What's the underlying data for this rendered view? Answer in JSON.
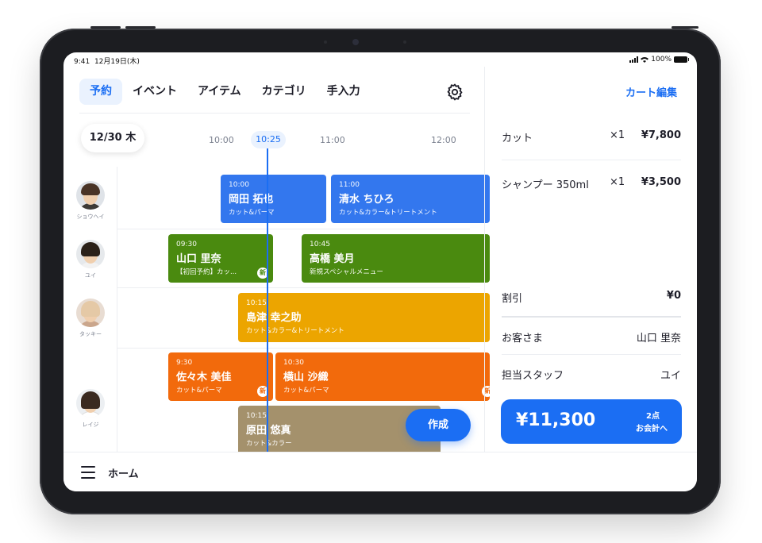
{
  "status_bar": {
    "time": "9:41",
    "date": "12月19日(木)",
    "battery": "100%"
  },
  "tabs": [
    {
      "label": "予約",
      "active": true
    },
    {
      "label": "イベント"
    },
    {
      "label": "アイテム"
    },
    {
      "label": "カテゴリ"
    },
    {
      "label": "手入力"
    }
  ],
  "calendar": {
    "date": "12/30 木",
    "current_time": "10:25",
    "time_labels": [
      "10:00",
      "11:00",
      "12:00"
    ]
  },
  "staff": [
    {
      "name": "ショウヘイ"
    },
    {
      "name": "ユイ"
    },
    {
      "name": "タッキー"
    },
    {
      "name": "レイジ"
    }
  ],
  "appointments": [
    {
      "time": "10:00",
      "customer": "岡田 拓也",
      "menu": "カット&パーマ",
      "new": false,
      "color": "#3377ee"
    },
    {
      "time": "11:00",
      "customer": "清水 ちひろ",
      "menu": "カット&カラー&トリートメント",
      "new": false,
      "color": "#3377ee"
    },
    {
      "time": "09:30",
      "customer": "山口 里奈",
      "menu": "【初回予約】カッ...",
      "new": true,
      "new_label": "新",
      "color": "#4a8a0f"
    },
    {
      "time": "10:45",
      "customer": "高橋 美月",
      "menu": "新規スペシャルメニュー",
      "new": false,
      "color": "#4a8a0f"
    },
    {
      "time": "10:15",
      "customer": "島津 幸之助",
      "menu": "カット&カラー&トリートメント",
      "new": false,
      "color": "#eca500"
    },
    {
      "time": "9:30",
      "customer": "佐々木 美佳",
      "menu": "カット&パーマ",
      "new": true,
      "new_label": "新",
      "color": "#f26a0c"
    },
    {
      "time": "10:30",
      "customer": "横山 沙織",
      "menu": "カット&パーマ",
      "new": true,
      "new_label": "新",
      "color": "#f26a0c"
    },
    {
      "time": "10:15",
      "customer": "原田 悠真",
      "menu": "カット&カラー",
      "new": false,
      "color": "#a4916c"
    }
  ],
  "create_button": "作成",
  "bottom_bar": {
    "home_label": "ホーム"
  },
  "cart": {
    "edit_label": "カート編集",
    "items": [
      {
        "name": "カット",
        "qty": "×1",
        "price": "¥7,800"
      },
      {
        "name": "シャンプー 350ml",
        "qty": "×1",
        "price": "¥3,500"
      }
    ],
    "discount": {
      "label": "割引",
      "value": "¥0"
    },
    "customer": {
      "label": "お客さま",
      "value": "山口 里奈"
    },
    "staff": {
      "label": "担当スタッフ",
      "value": "ユイ"
    },
    "checkout": {
      "total": "¥11,300",
      "count": "2点",
      "action": "お会計へ"
    }
  },
  "colors": {
    "accent": "#1b6ef3"
  }
}
